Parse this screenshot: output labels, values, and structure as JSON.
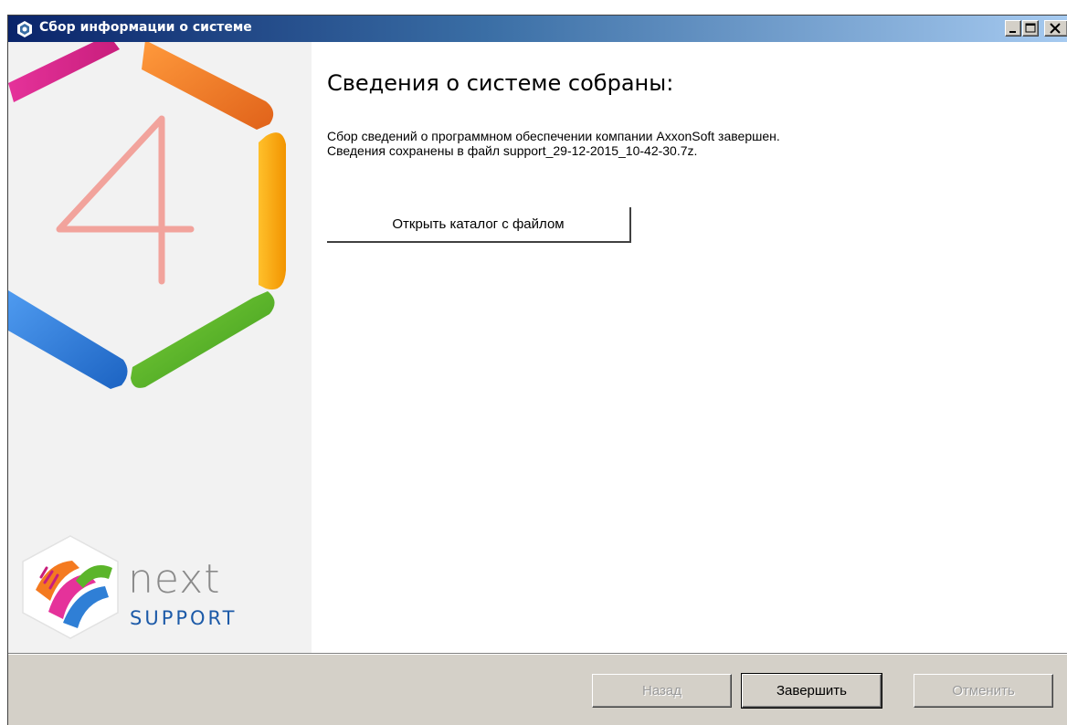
{
  "window": {
    "title": "Сбор информации о системе"
  },
  "branding": {
    "big_numeral": "4",
    "logo_word": "next",
    "logo_sub": "SUPPORT",
    "colors": {
      "magenta": "#d9268c",
      "orange": "#f47a20",
      "yellow": "#f7a800",
      "green": "#5bb52a",
      "blue": "#2f7fd6",
      "numeral": "#f2a39c"
    }
  },
  "main": {
    "heading": "Сведения о системе собраны:",
    "line1": "Сбор сведений о программном обеспечении компании AxxonSoft завершен.",
    "line2": "Сведения сохранены в файл support_29-12-2015_10-42-30.7z.",
    "open_folder_button": "Открыть каталог с файлом"
  },
  "footer": {
    "back": "Назад",
    "finish": "Завершить",
    "cancel": "Отменить"
  }
}
